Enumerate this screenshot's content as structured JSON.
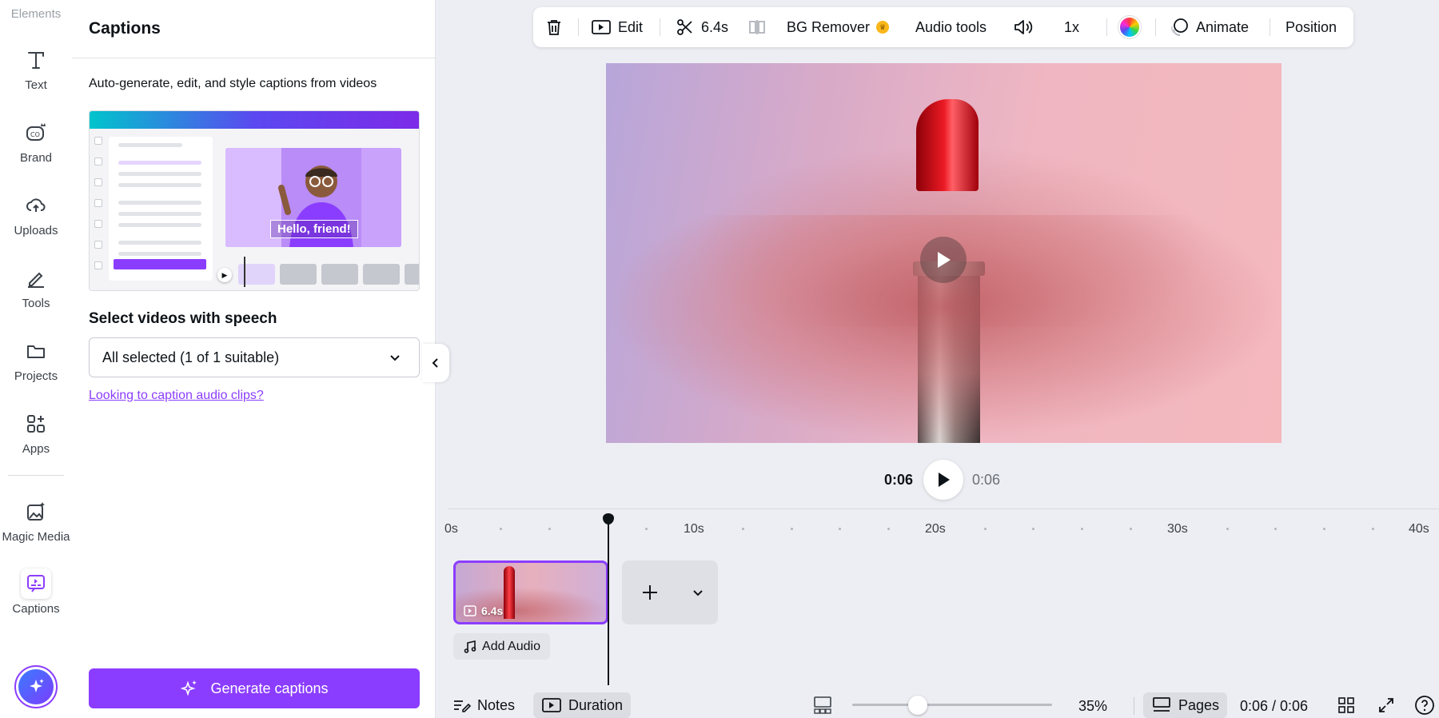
{
  "rail": {
    "top_label": "Elements",
    "items": [
      {
        "label": "Text",
        "icon": "text-icon"
      },
      {
        "label": "Brand",
        "icon": "brand-icon"
      },
      {
        "label": "Uploads",
        "icon": "upload-cloud-icon"
      },
      {
        "label": "Tools",
        "icon": "pen-tool-icon"
      },
      {
        "label": "Projects",
        "icon": "folder-icon"
      },
      {
        "label": "Apps",
        "icon": "apps-grid-icon"
      },
      {
        "label": "Magic Media",
        "icon": "magic-media-icon"
      },
      {
        "label": "Captions",
        "icon": "captions-icon"
      }
    ]
  },
  "panel": {
    "title": "Captions",
    "description": "Auto-generate, edit, and style captions from videos",
    "illustration_caption": "Hello, friend!",
    "select_label": "Select videos with speech",
    "select_value": "All selected (1 of 1 suitable)",
    "audio_link": "Looking to caption audio clips?",
    "generate_button": "Generate captions"
  },
  "toolbar": {
    "edit": "Edit",
    "split_duration": "6.4s",
    "bg_remover": "BG Remover",
    "audio_tools": "Audio tools",
    "speed": "1x",
    "animate": "Animate",
    "position": "Position"
  },
  "playback": {
    "current": "0:06",
    "total": "0:06"
  },
  "timeline": {
    "ticks": [
      "0s",
      "10s",
      "20s",
      "30s",
      "40s"
    ],
    "clip_duration": "6.4s",
    "add_audio": "Add Audio"
  },
  "bottom": {
    "notes": "Notes",
    "duration": "Duration",
    "zoom": "35%",
    "zoom_fraction": 0.35,
    "pages": "Pages",
    "page_time": "0:06 / 0:06"
  },
  "colors": {
    "accent": "#8b3dff",
    "background": "#edeef3"
  }
}
